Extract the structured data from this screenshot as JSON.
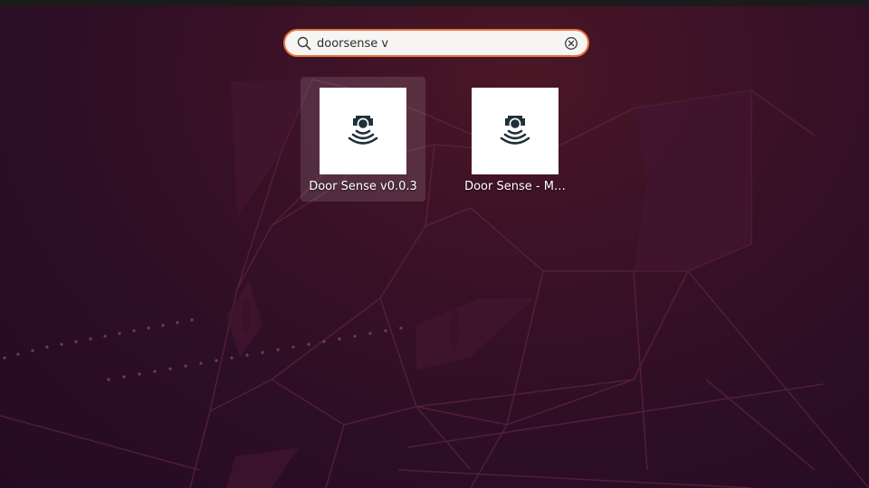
{
  "search": {
    "query": "doorsense v",
    "search_icon": "search-icon",
    "clear_icon": "clear-circle-x-icon"
  },
  "results": [
    {
      "label": "Door Sense v0.0.3",
      "icon": "door-sensor-icon",
      "selected": true
    },
    {
      "label": "Door Sense - M…",
      "icon": "door-sensor-icon",
      "selected": false
    }
  ],
  "colors": {
    "accent": "#e9733f",
    "icon_dark": "#1f3038",
    "background": "#2c0e26"
  }
}
